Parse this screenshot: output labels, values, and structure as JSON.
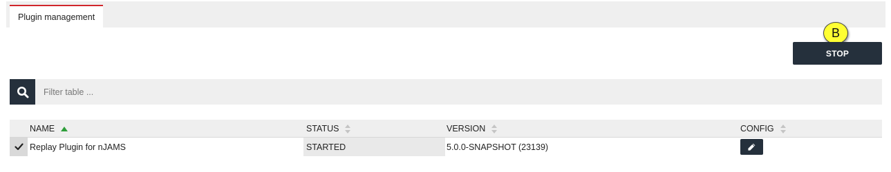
{
  "tabs": [
    {
      "label": "Plugin management",
      "active": true
    }
  ],
  "actions": {
    "stop_label": "STOP",
    "marker_label": "B"
  },
  "filter": {
    "placeholder": "Filter table ...",
    "value": "",
    "search_icon": "search-icon"
  },
  "table": {
    "columns": [
      {
        "label": "NAME",
        "sort": "ascending"
      },
      {
        "label": "STATUS",
        "sort": "none"
      },
      {
        "label": "VERSION",
        "sort": "none"
      },
      {
        "label": "CONFIG",
        "sort": "none"
      }
    ],
    "rows": [
      {
        "selected": true,
        "name": "Replay Plugin for nJAMS",
        "status": "STARTED",
        "version": "5.0.0-SNAPSHOT (23139)",
        "config_icon": "pencil-icon"
      }
    ]
  },
  "colors": {
    "accent_tab": "#d0262b",
    "dark_button": "#25303c",
    "marker": "#ffff33",
    "sort_active": "#2e9e3a",
    "sort_inactive": "#c4c4c4"
  }
}
